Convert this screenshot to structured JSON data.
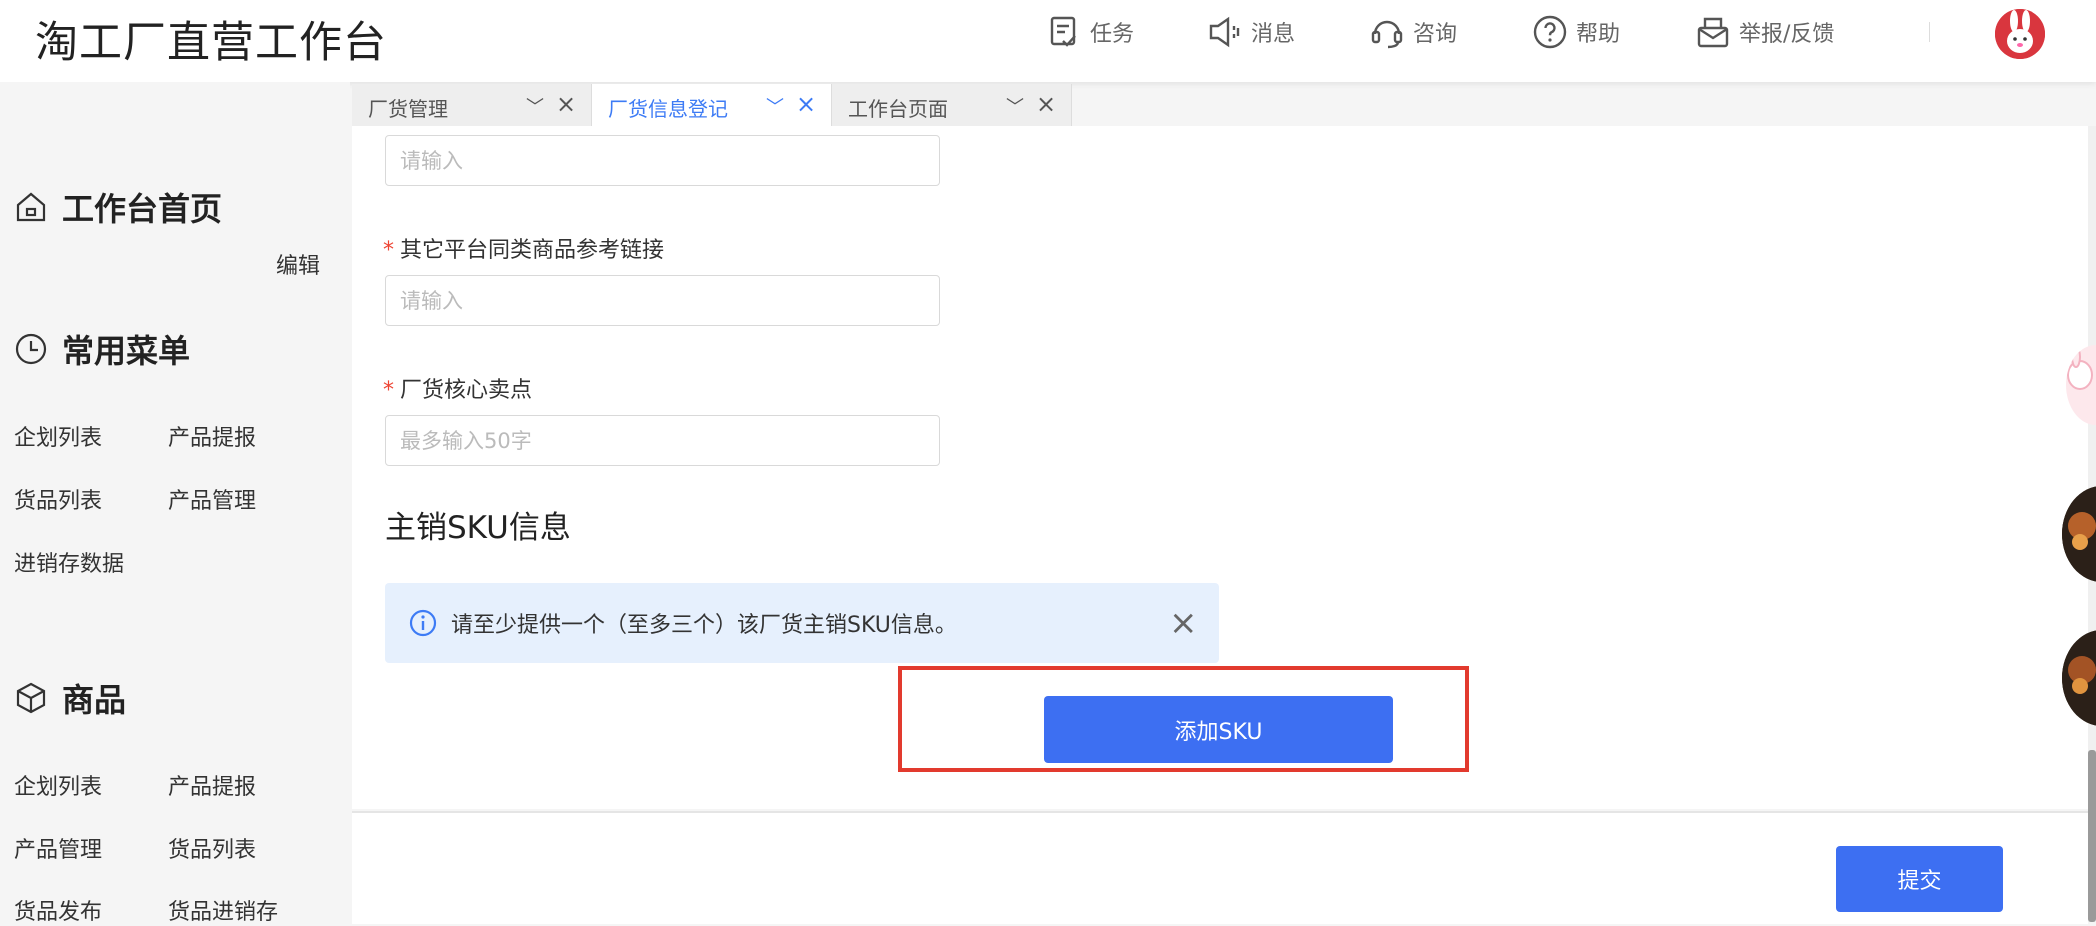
{
  "header": {
    "title": "淘工厂直营工作台",
    "nav": [
      {
        "icon": "task-icon",
        "label": "任务"
      },
      {
        "icon": "speaker-icon",
        "label": "消息"
      },
      {
        "icon": "headset-icon",
        "label": "咨询"
      },
      {
        "icon": "help-icon",
        "label": "帮助"
      },
      {
        "icon": "report-icon",
        "label": "举报/反馈"
      }
    ]
  },
  "sidebar": {
    "home": "工作台首页",
    "common_menu": "常用菜单",
    "edit": "编辑",
    "common_links": [
      "企划列表",
      "产品提报",
      "货品列表",
      "产品管理",
      "进销存数据"
    ],
    "goods": "商品",
    "goods_links": [
      "企划列表",
      "产品提报",
      "产品管理",
      "货品列表",
      "货品发布",
      "货品进销存"
    ]
  },
  "tabs": [
    {
      "label": "厂货管理",
      "active": false
    },
    {
      "label": "厂货信息登记",
      "active": true
    },
    {
      "label": "工作台页面",
      "active": false
    }
  ],
  "form": {
    "top_input_placeholder": "请输入",
    "reference_link_label": "其它平台同类商品参考链接",
    "reference_link_placeholder": "请输入",
    "selling_point_label": "厂货核心卖点",
    "selling_point_placeholder": "最多输入50字",
    "sku_section_title": "主销SKU信息",
    "sku_alert": "请至少提供一个（至多三个）该厂货主销SKU信息。",
    "add_sku_button": "添加SKU",
    "submit_button": "提交"
  },
  "colors": {
    "primary": "#3d6ff2",
    "active_tab": "#3d7bf5",
    "required": "#e43",
    "highlight": "#e23a2e",
    "alert_bg": "#e6f0fd"
  }
}
